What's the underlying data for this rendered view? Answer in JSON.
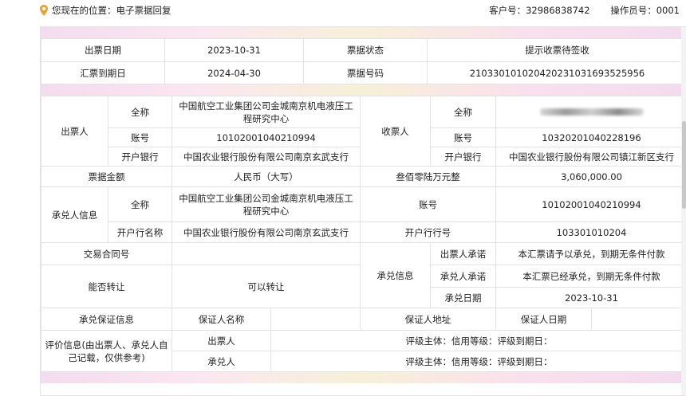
{
  "location": {
    "label": "您现在的位置：电子票据回复"
  },
  "header": {
    "customer_no": "客户号：32986838742",
    "operator_no": "操作员号：0001"
  },
  "summary": {
    "issue_date_label": "出票日期",
    "issue_date": "2023-10-31",
    "status_label": "票据状态",
    "status": "提示收票待签收",
    "due_date_label": "汇票到期日",
    "due_date": "2024-04-30",
    "bill_no_label": "票据号码",
    "bill_no": "210330101020420231031693525956"
  },
  "drawer": {
    "title": "出票人",
    "name_label": "全称",
    "name": "中国航空工业集团公司金城南京机电液压工程研究中心",
    "acct_label": "账号",
    "acct": "10102001040210994",
    "bank_label": "开户银行",
    "bank": "中国农业银行股份有限公司南京玄武支行"
  },
  "payee": {
    "title": "收票人",
    "name_label": "全称",
    "acct_label": "账号",
    "acct": "10320201040228196",
    "bank_label": "开户银行",
    "bank": "中国农业银行股份有限公司镇江新区支行"
  },
  "amount": {
    "label": "票据金额",
    "currency": "人民币（大写）",
    "words": "叁佰零陆万元整",
    "value": "3,060,000.00"
  },
  "acceptor": {
    "title": "承兑人信息",
    "name_label": "全称",
    "name": "中国航空工业集团公司金城南京机电液压工程研究中心",
    "acct_label": "账号",
    "acct": "10102001040210994",
    "bank_label": "开户行名称",
    "bank": "中国农业银行股份有限公司南京玄武支行",
    "bank_no_label": "开户行行号",
    "bank_no": "103301010204"
  },
  "contract": {
    "label": "交易合同号"
  },
  "accept_info": {
    "title": "承兑信息",
    "drawer_promise_label": "出票人承诺",
    "drawer_promise": "本汇票请予以承兑，到期无条件付款",
    "acceptor_promise_label": "承兑人承诺",
    "acceptor_promise": "本汇票已经承兑，到期无条件付款",
    "date_label": "承兑日期",
    "date": "2023-10-31"
  },
  "transfer": {
    "label": "能否转让",
    "value": "可以转让"
  },
  "guarantee": {
    "label": "承兑保证信息",
    "name_label": "保证人名称",
    "addr_label": "保证人地址",
    "date_label": "保证人日期"
  },
  "rating": {
    "title": "评价信息(由出票人、承兑人自己记载，仅供参考)",
    "drawer_label": "出票人",
    "acceptor_label": "承兑人",
    "fields": "评级主体：信用等级：评级到期日："
  },
  "colors": {
    "accent": "#e8a33a",
    "border": "#e2e2e2",
    "band": "#f6e0f0"
  }
}
